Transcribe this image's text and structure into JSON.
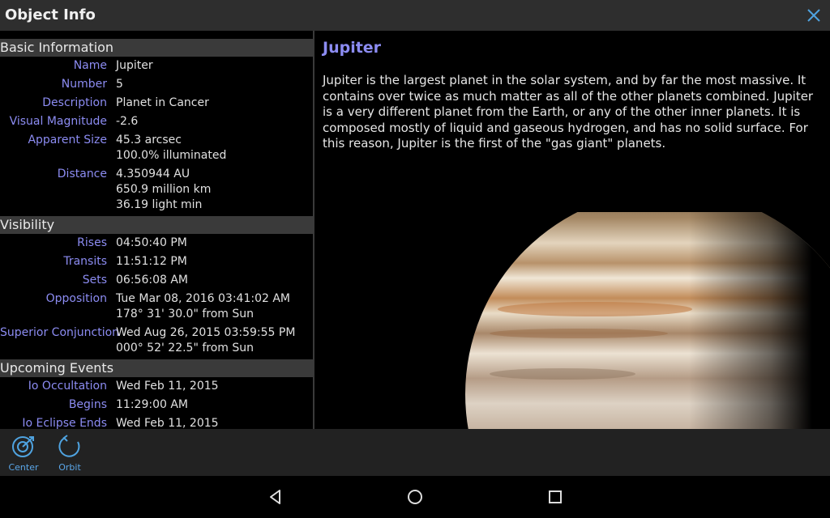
{
  "title": "Object Info",
  "icons": {
    "close": "close-icon",
    "center": "target-icon",
    "orbit": "orbit-icon"
  },
  "colors": {
    "label": "#8c8cf2",
    "accent": "#4fa3e0"
  },
  "sections": [
    {
      "header": "Basic Information",
      "rows": [
        {
          "label": "Name",
          "values": [
            "Jupiter"
          ]
        },
        {
          "label": "Number",
          "values": [
            "5"
          ]
        },
        {
          "label": "Description",
          "values": [
            "Planet in Cancer"
          ]
        },
        {
          "label": "Visual Magnitude",
          "values": [
            "-2.6"
          ]
        },
        {
          "label": "Apparent Size",
          "values": [
            "45.3 arcsec",
            "100.0% illuminated"
          ]
        },
        {
          "label": "Distance",
          "values": [
            "4.350944 AU",
            "650.9 million km",
            "36.19 light min"
          ]
        }
      ]
    },
    {
      "header": "Visibility",
      "rows": [
        {
          "label": "Rises",
          "values": [
            "04:50:40 PM"
          ]
        },
        {
          "label": "Transits",
          "values": [
            "11:51:12 PM"
          ]
        },
        {
          "label": "Sets",
          "values": [
            "06:56:08 AM"
          ]
        },
        {
          "label": "Opposition",
          "values": [
            "Tue Mar 08, 2016  03:41:02 AM",
            "178° 31' 30.0\" from Sun"
          ]
        },
        {
          "label": "Superior Conjunction",
          "values": [
            "Wed Aug 26, 2015  03:59:55 PM",
            "000° 52' 22.5\" from Sun"
          ]
        }
      ]
    },
    {
      "header": "Upcoming Events",
      "rows": [
        {
          "label": "Io Occultation",
          "values": [
            "Wed Feb 11, 2015"
          ]
        },
        {
          "label": "Begins",
          "values": [
            "11:29:00 AM"
          ]
        },
        {
          "label": "Io Eclipse Ends",
          "values": [
            "Wed Feb 11, 2015"
          ]
        }
      ]
    }
  ],
  "object": {
    "name": "Jupiter",
    "description": "Jupiter is the largest planet in the solar system, and by far the most massive. It contains over twice as much matter as all of the other planets combined. Jupiter is a very different planet from the Earth, or any of the other inner planets. It is composed mostly of liquid and gaseous hydrogen, and has no solid surface. For this reason, Jupiter is the first of the \"gas giant\" planets."
  },
  "toolbar": {
    "center_label": "Center",
    "orbit_label": "Orbit"
  }
}
